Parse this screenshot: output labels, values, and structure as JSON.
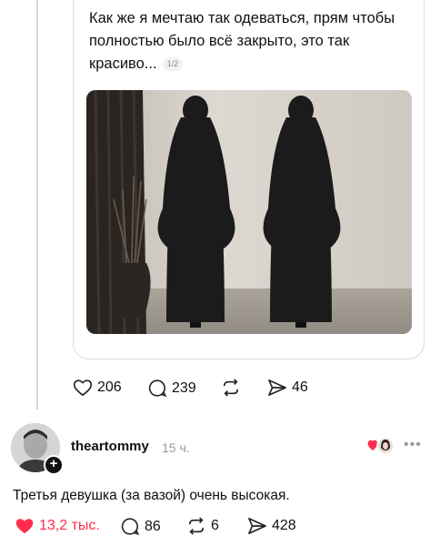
{
  "quoted_post": {
    "text": "Как же я мечтаю так одеваться, прям чтобы полностью было всё закрыто, это так красиво...",
    "page_indicator": "1/2",
    "image": "two-black-robes-on-mannequins"
  },
  "quoted_actions": {
    "likes": "206",
    "comments": "239",
    "reposts": "",
    "shares": "46"
  },
  "reply": {
    "username": "theartommy",
    "time": "15 ч.",
    "text": "Третья девушка (за вазой) очень высокая.",
    "more": "•••"
  },
  "reply_actions": {
    "likes": "13,2 тыс.",
    "comments": "86",
    "reposts": "6",
    "shares": "428"
  },
  "colors": {
    "like_red": "#ff2d4a",
    "robe": "#1a1a1a",
    "wall": "#d8d3cc"
  }
}
